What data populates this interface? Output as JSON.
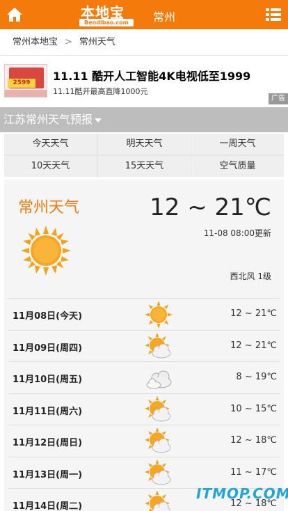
{
  "header": {
    "logo_main": "本地宝",
    "logo_sub": "Bendibao.com",
    "city": "常州",
    "brand_color": "#f47a0b",
    "home_icon": "home-icon",
    "menu_icon": "list-menu-icon"
  },
  "breadcrumb": {
    "items": [
      "常州本地宝",
      "常州天气"
    ],
    "separator": ">"
  },
  "ad": {
    "title": "11.11 酷开人工智能4K电视低至1999",
    "subtitle": "11.11酷开最高直降1000元",
    "badge": "广告",
    "thumb_price": "2599"
  },
  "section": {
    "title": "江苏常州天气预报"
  },
  "tabs": [
    "今天天气",
    "明天天气",
    "一周天气",
    "10天天气",
    "15天天气",
    "空气质量"
  ],
  "current": {
    "city_title": "常州天气",
    "temp_range": "12 ~ 21℃",
    "updated": "11-08 08:00更新",
    "wind": "西北风 1级",
    "icon": "sunny-icon"
  },
  "forecast": [
    {
      "date": "11月08日(今天)",
      "icon": "sunny",
      "temp": "12 ~ 21℃"
    },
    {
      "date": "11月09日(周四)",
      "icon": "partly-cloudy",
      "temp": "12 ~ 21℃"
    },
    {
      "date": "11月10日(周五)",
      "icon": "cloudy",
      "temp": "8 ~ 19℃"
    },
    {
      "date": "11月11日(周六)",
      "icon": "partly-cloudy",
      "temp": "10 ~ 15℃"
    },
    {
      "date": "11月12日(周日)",
      "icon": "partly-cloudy",
      "temp": "12 ~ 18℃"
    },
    {
      "date": "11月13日(周一)",
      "icon": "partly-cloudy",
      "temp": "11 ~ 17℃"
    },
    {
      "date": "11月14日(周二)",
      "icon": "partly-cloudy",
      "temp": "12 ~ 18℃"
    }
  ],
  "watermark": "ITMOP.COM"
}
